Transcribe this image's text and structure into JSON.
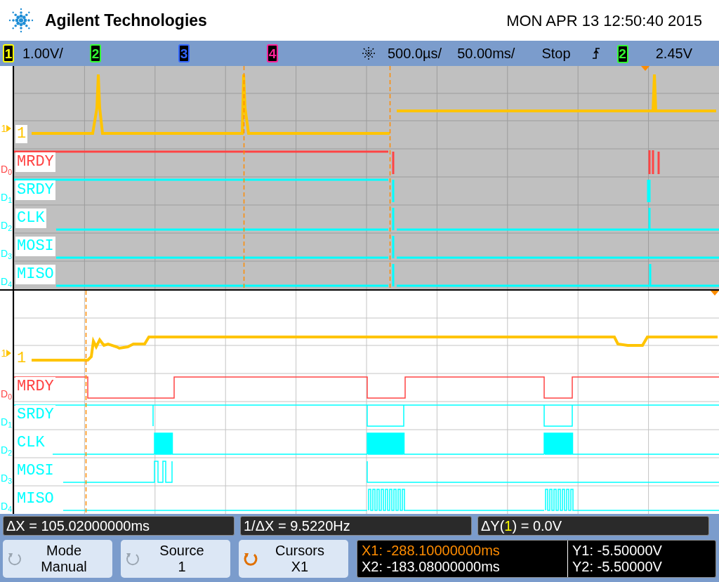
{
  "header": {
    "brand": "Agilent Technologies",
    "datetime": "MON APR 13 12:50:40 2015"
  },
  "status_bar": {
    "channels": [
      {
        "label": "1",
        "color": "#ffff00",
        "scale": "1.00V/"
      },
      {
        "label": "2",
        "color": "#33ff33"
      },
      {
        "label": "3",
        "color": "#3366ff"
      },
      {
        "label": "4",
        "color": "#ff2299"
      }
    ],
    "timebase_main": "500.0µs/",
    "timebase_zoom": "50.00ms/",
    "run_state": "Stop",
    "trigger_source": {
      "label": "2",
      "color": "#33ff33"
    },
    "trigger_level": "2.45V"
  },
  "panes": [
    {
      "kind": "main",
      "analog": {
        "marker": "1",
        "label": "1"
      },
      "digital": [
        {
          "marker": "D$_{0}$",
          "name": "MRDY",
          "color": "#ff4444"
        },
        {
          "marker": "D$_{1}$",
          "name": "SRDY",
          "color": "#00ffff"
        },
        {
          "marker": "D$_{2}$",
          "name": "CLK",
          "color": "#00ffff"
        },
        {
          "marker": "D$_{3}$",
          "name": "MOSI",
          "color": "#00ffff"
        },
        {
          "marker": "D$_{4}$",
          "name": "MISO",
          "color": "#00ffff"
        }
      ]
    },
    {
      "kind": "zoom",
      "analog": {
        "marker": "1",
        "label": "1"
      },
      "digital": [
        {
          "marker": "D$_{0}$",
          "name": "MRDY",
          "color": "#ff4444"
        },
        {
          "marker": "D$_{1}$",
          "name": "SRDY",
          "color": "#00ffff"
        },
        {
          "marker": "D$_{2}$",
          "name": "CLK",
          "color": "#00ffff"
        },
        {
          "marker": "D$_{3}$",
          "name": "MOSI",
          "color": "#00ffff"
        },
        {
          "marker": "D$_{4}$",
          "name": "MISO",
          "color": "#00ffff"
        }
      ]
    }
  ],
  "measurements": [
    {
      "text": "ΔX = 105.02000000ms"
    },
    {
      "text": "1/ΔX = 9.5220Hz"
    },
    {
      "prefix": "ΔY(",
      "channel": "1",
      "color": "#ffff00",
      "suffix": ") = 0.0V"
    }
  ],
  "softkeys": [
    {
      "title": "Mode",
      "value": "Manual",
      "selected": false
    },
    {
      "title": "Source",
      "value": "1",
      "selected": false
    },
    {
      "title": "Cursors",
      "value": "X1",
      "selected": true
    }
  ],
  "readout": {
    "x": [
      {
        "text": "X1: -288.10000000ms",
        "selected": true
      },
      {
        "text": "X2: -183.08000000ms",
        "selected": false
      }
    ],
    "y": [
      "Y1: -5.50000V",
      "Y2: -5.50000V"
    ]
  }
}
